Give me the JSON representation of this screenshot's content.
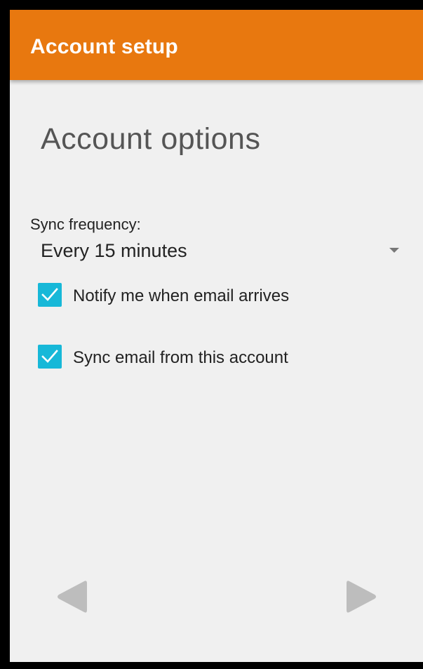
{
  "appbar": {
    "title": "Account setup",
    "color": "#e8780f"
  },
  "page": {
    "title": "Account options"
  },
  "sync_frequency": {
    "label": "Sync frequency:",
    "selected": "Every 15 minutes"
  },
  "options": [
    {
      "label": "Notify me when email arrives",
      "checked": true
    },
    {
      "label": "Sync email from this account",
      "checked": true
    }
  ],
  "nav": {
    "prev_icon": "arrow-left-icon",
    "next_icon": "arrow-right-icon"
  },
  "colors": {
    "accent": "#17b8d8",
    "background": "#f0f0f0",
    "nav_arrow": "#bdbdbd"
  }
}
